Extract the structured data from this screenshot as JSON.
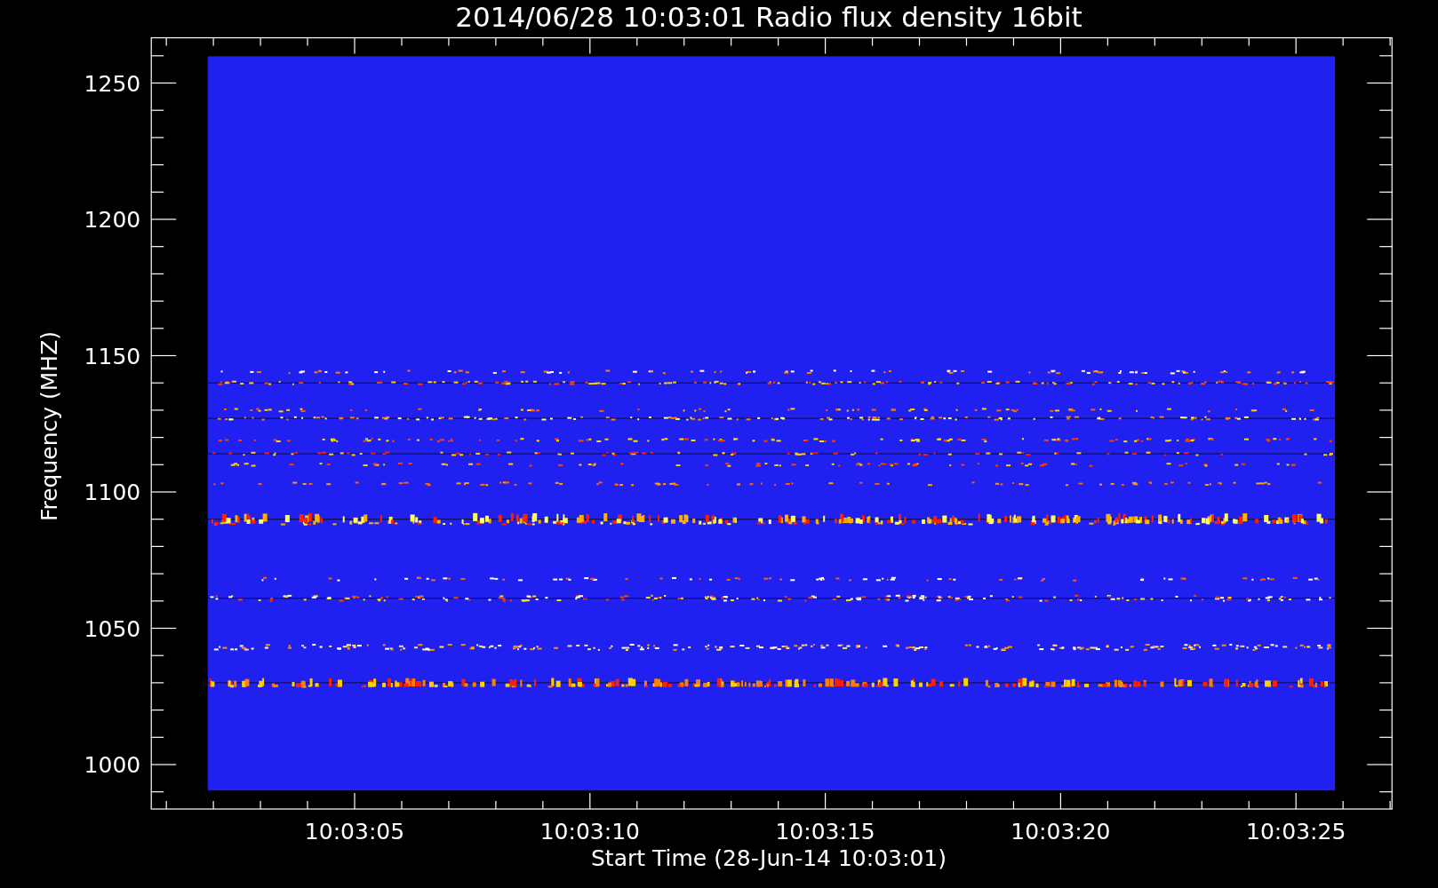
{
  "plot": {
    "title": "2014/06/28 10:03:01 Radio flux density 16bit",
    "xlabel": "Start Time (28-Jun-14 10:03:01)",
    "ylabel": "Frequency (MHZ)",
    "xticks": [
      "10:03:05",
      "10:03:10",
      "10:03:15",
      "10:03:20",
      "10:03:25"
    ],
    "yticks": [
      "1250",
      "1200",
      "1150",
      "1100",
      "1050",
      "1000"
    ]
  }
}
